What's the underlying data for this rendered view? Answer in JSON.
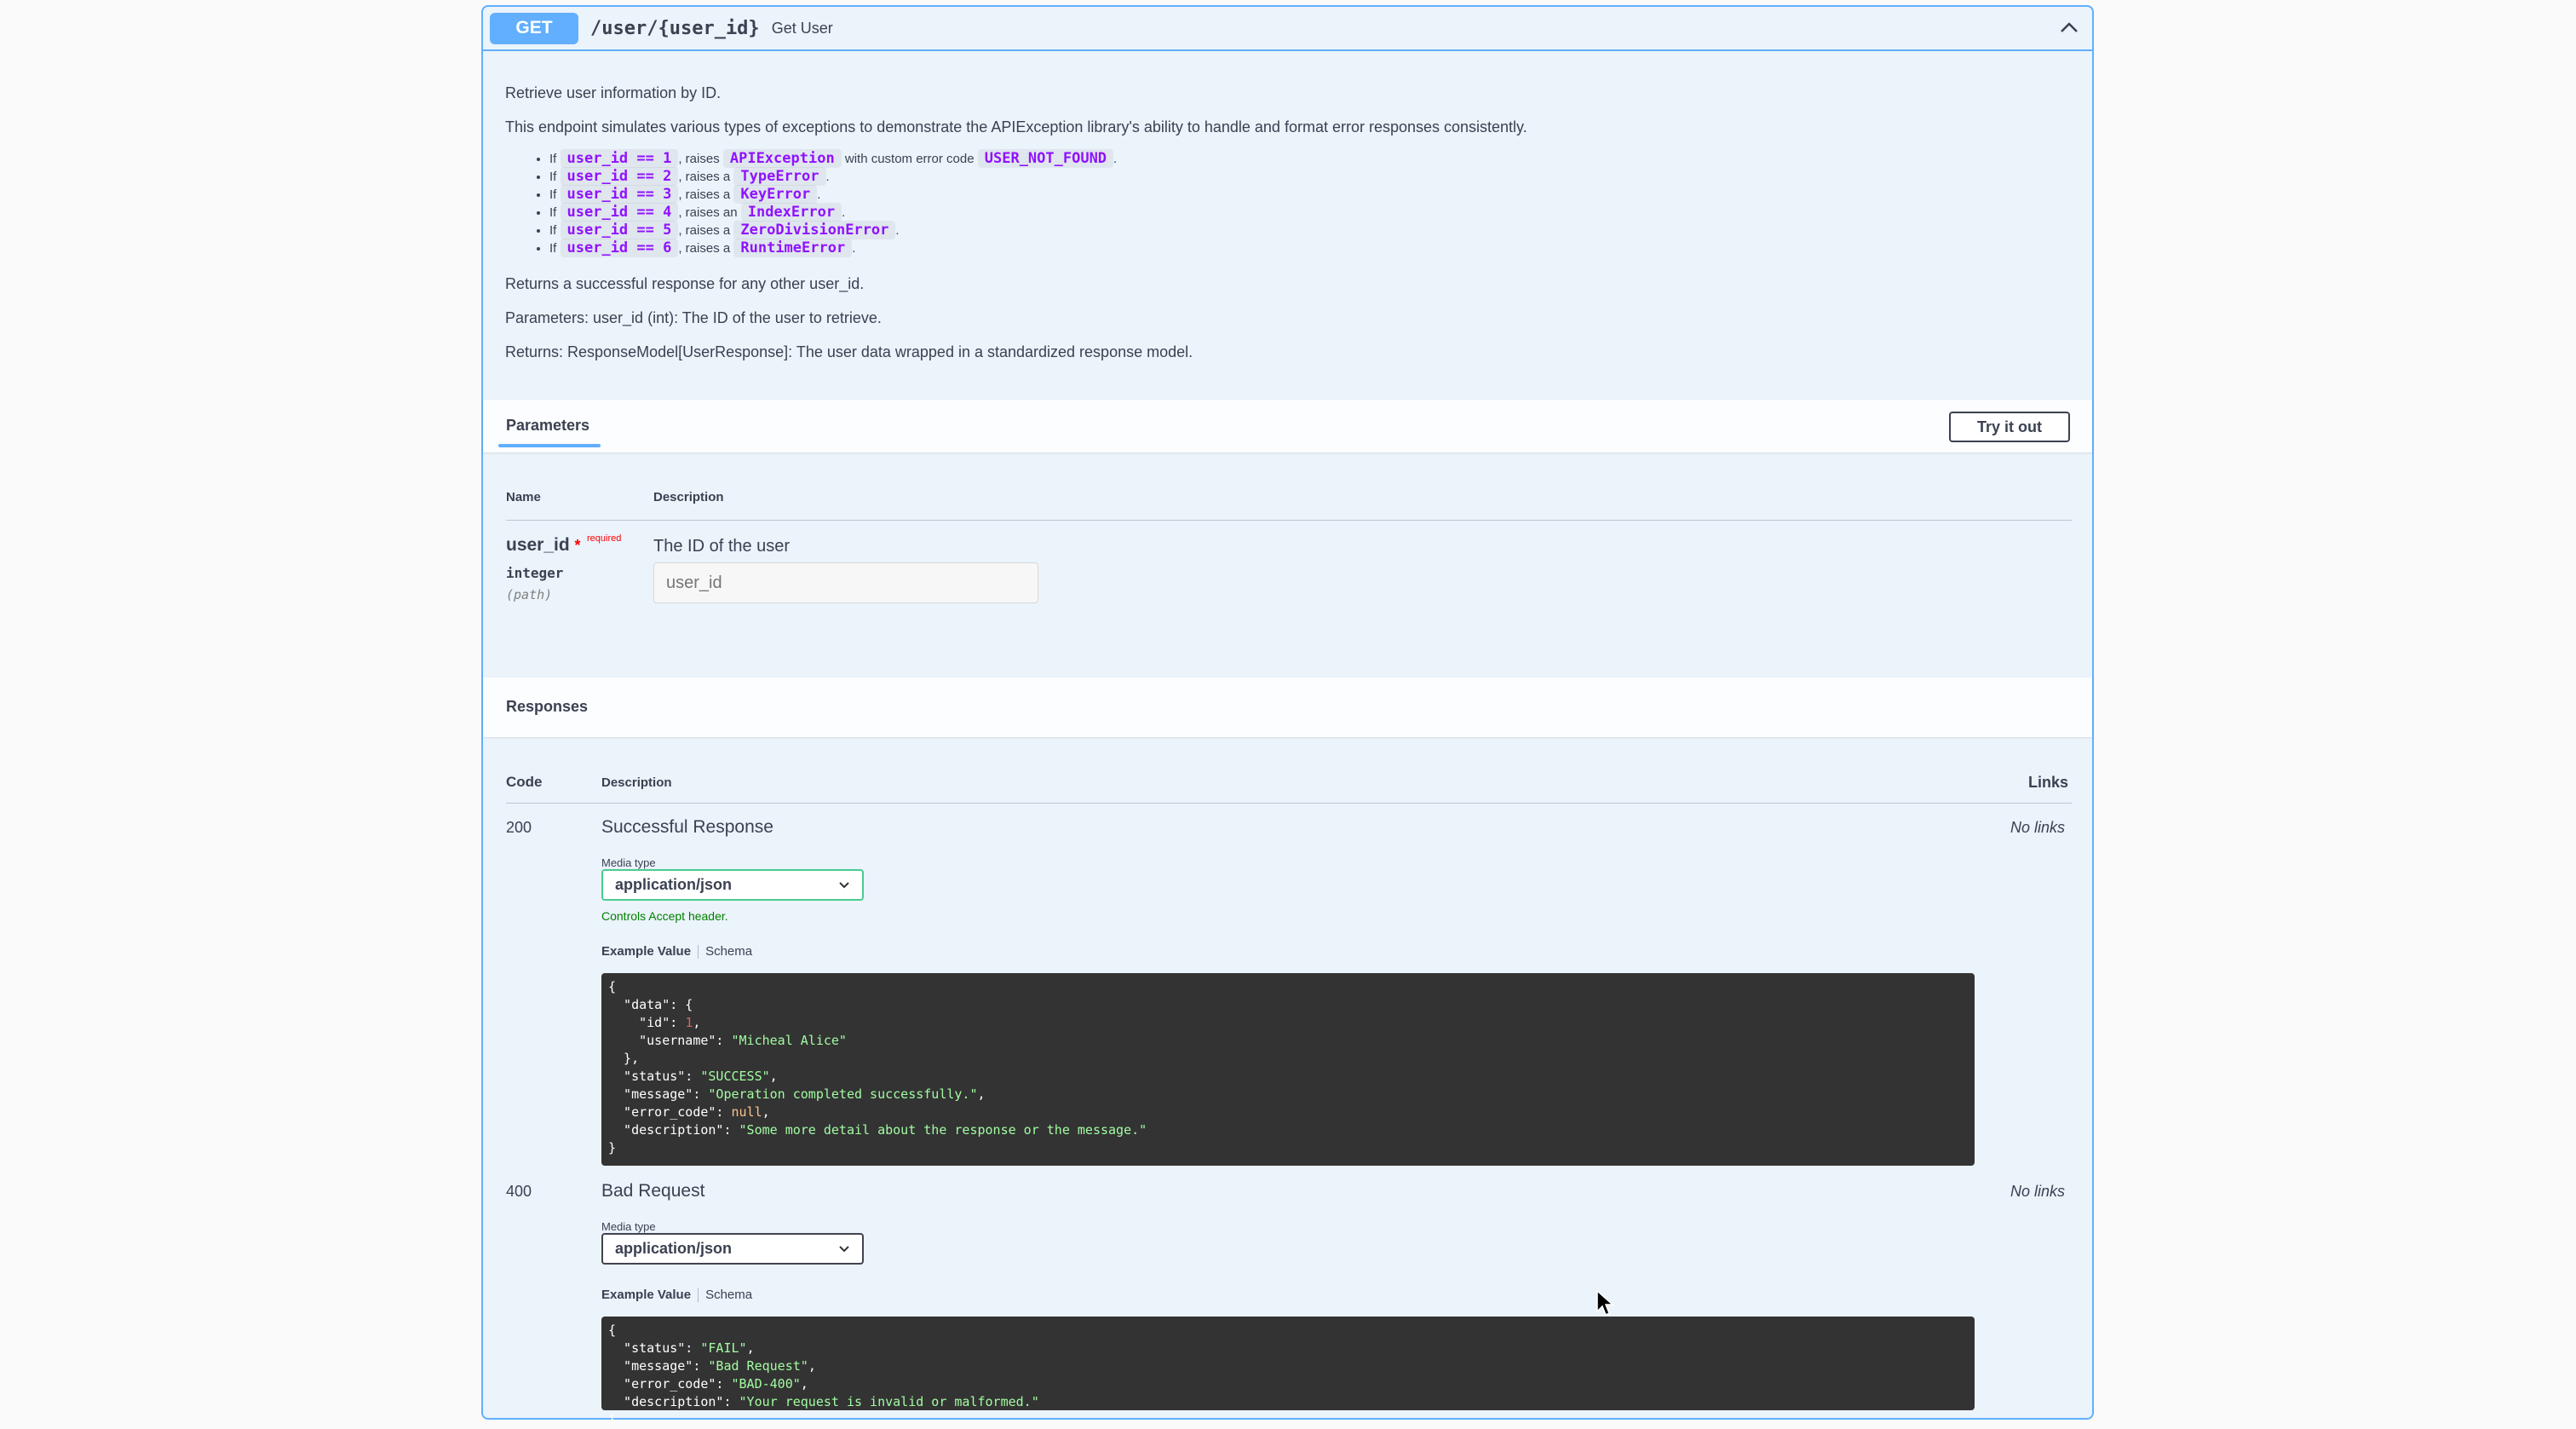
{
  "operation": {
    "method": "GET",
    "path": "/user/{user_id}",
    "summary": "Get User"
  },
  "description": {
    "p1": "Retrieve user information by ID.",
    "p2": "This endpoint simulates various types of exceptions to demonstrate the APIException library's ability to handle and format error responses consistently.",
    "items": [
      {
        "pre": "If ",
        "code1": "user_id == 1",
        "mid": ", raises ",
        "code2": "APIException",
        "post": " with custom error code ",
        "code3": "USER_NOT_FOUND",
        "end": "."
      },
      {
        "pre": "If ",
        "code1": "user_id == 2",
        "mid": ", raises a ",
        "code2": "TypeError",
        "end": "."
      },
      {
        "pre": "If ",
        "code1": "user_id == 3",
        "mid": ", raises a ",
        "code2": "KeyError",
        "end": "."
      },
      {
        "pre": "If ",
        "code1": "user_id == 4",
        "mid": ", raises an ",
        "code2": "IndexError",
        "end": "."
      },
      {
        "pre": "If ",
        "code1": "user_id == 5",
        "mid": ", raises a ",
        "code2": "ZeroDivisionError",
        "end": "."
      },
      {
        "pre": "If ",
        "code1": "user_id == 6",
        "mid": ", raises a ",
        "code2": "RuntimeError",
        "end": "."
      }
    ],
    "p3": "Returns a successful response for any other user_id.",
    "p4": "Parameters: user_id (int): The ID of the user to retrieve.",
    "p5": "Returns: ResponseModel[UserResponse]: The user data wrapped in a standardized response model."
  },
  "parameters": {
    "tab_label": "Parameters",
    "try_label": "Try it out",
    "col_name": "Name",
    "col_desc": "Description",
    "param": {
      "name": "user_id",
      "star": "*",
      "required": "required",
      "type": "integer",
      "in": "(path)",
      "description": "The ID of the user",
      "placeholder": "user_id"
    }
  },
  "responses": {
    "title": "Responses",
    "col_code": "Code",
    "col_desc": "Description",
    "col_links": "Links",
    "r200": {
      "code": "200",
      "description": "Successful Response",
      "links": "No links",
      "media_label": "Media type",
      "media_value": "application/json",
      "accept_note": "Controls Accept header.",
      "tab_example": "Example Value",
      "tab_schema": "Schema"
    },
    "r400": {
      "code": "400",
      "description": "Bad Request",
      "links": "No links",
      "media_label": "Media type",
      "media_value": "application/json",
      "tab_example": "Example Value",
      "tab_schema": "Schema"
    }
  }
}
